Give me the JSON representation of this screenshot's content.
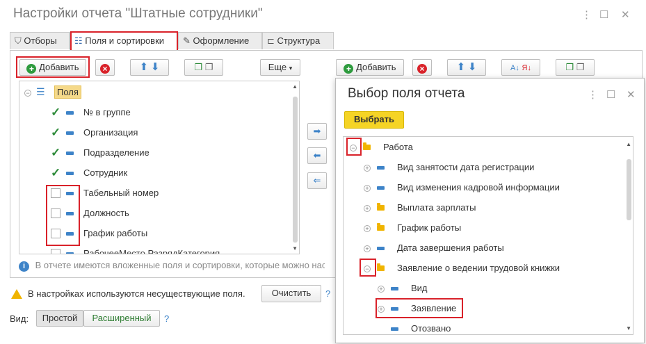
{
  "window": {
    "title": "Настройки отчета \"Штатные сотрудники\""
  },
  "tabs": [
    {
      "label": "Отборы",
      "icon": "filter-icon"
    },
    {
      "label": "Поля и сортировки",
      "icon": "fields-sort-icon"
    },
    {
      "label": "Оформление",
      "icon": "brush-icon"
    },
    {
      "label": "Структура",
      "icon": "structure-icon"
    }
  ],
  "toolbar_left": {
    "add_label": "Добавить",
    "more_label": "Еще"
  },
  "toolbar_right": {
    "add_label": "Добавить"
  },
  "fields_tree": {
    "root_label": "Поля",
    "items": [
      {
        "label": "№ в группе",
        "checked": true
      },
      {
        "label": "Организация",
        "checked": true
      },
      {
        "label": "Подразделение",
        "checked": true
      },
      {
        "label": "Сотрудник",
        "checked": true
      },
      {
        "label": "Табельный номер",
        "checked": false
      },
      {
        "label": "Должность",
        "checked": false
      },
      {
        "label": "График работы",
        "checked": false
      },
      {
        "label": "РабочееМесто.РазрядКатегория",
        "checked": false
      }
    ]
  },
  "info_text": "В отчете имеются вложенные поля и сортировки, которые можно настроить",
  "warning": {
    "text": "В настройках используются несуществующие поля.",
    "clear_label": "Очистить",
    "help": "?"
  },
  "view": {
    "label": "Вид:",
    "simple": "Простой",
    "extended": "Расширенный",
    "help": "?"
  },
  "dialog": {
    "title": "Выбор поля отчета",
    "select_label": "Выбрать",
    "tree": [
      {
        "label": "Работа",
        "level": 0,
        "type": "folder",
        "toggle": "⊖"
      },
      {
        "label": "Вид занятости дата регистрации",
        "level": 1,
        "type": "field",
        "toggle": "⊕"
      },
      {
        "label": "Вид изменения кадровой информации",
        "level": 1,
        "type": "field",
        "toggle": "⊕"
      },
      {
        "label": "Выплата зарплаты",
        "level": 1,
        "type": "folder",
        "toggle": "⊕"
      },
      {
        "label": "График работы",
        "level": 1,
        "type": "folder",
        "toggle": "⊕"
      },
      {
        "label": "Дата завершения работы",
        "level": 1,
        "type": "field",
        "toggle": "⊕"
      },
      {
        "label": "Заявление о ведении трудовой книжки",
        "level": 1,
        "type": "folder",
        "toggle": "⊖"
      },
      {
        "label": "Вид",
        "level": 2,
        "type": "field",
        "toggle": "⊕"
      },
      {
        "label": "Заявление",
        "level": 2,
        "type": "field",
        "toggle": "⊕"
      },
      {
        "label": "Отозвано",
        "level": 2,
        "type": "field",
        "toggle": ""
      }
    ]
  },
  "colors": {
    "highlight_red": "#d9222a",
    "select_yellow": "#f5d425",
    "check_green": "#2e8b3a",
    "field_blue": "#3d83c8"
  }
}
